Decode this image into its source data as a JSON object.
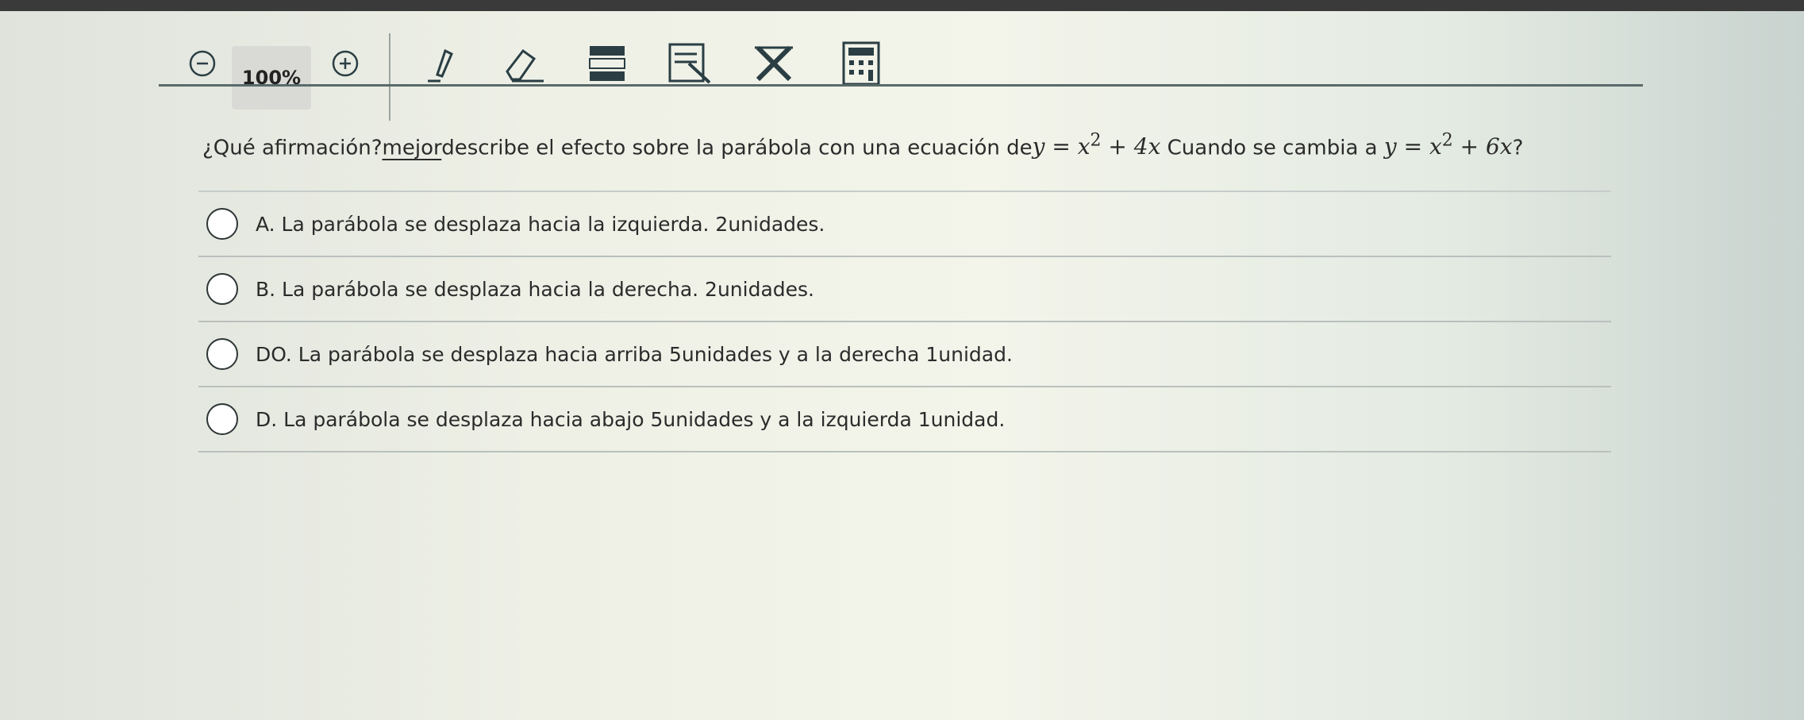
{
  "toolbar": {
    "zoom_level": "100%",
    "icons": [
      "zoom-out-icon",
      "zoom-in-icon",
      "pencil-icon",
      "eraser-icon",
      "line-reader-icon",
      "answer-masking-icon",
      "cross-out-icon",
      "calculator-icon"
    ]
  },
  "question": {
    "part1": "¿Qué afirmación?",
    "part2": "mejor",
    "part3": "describe el efecto sobre la parábola con una ecuación de",
    "eq1_a": "y = x",
    "eq1_exp": "2",
    "eq1_b": " + 4x",
    "part4": " Cuando se cambia a",
    "eq2_a": "y = x",
    "eq2_exp": "2",
    "eq2_b": " + 6x",
    "end": "?"
  },
  "options": [
    {
      "text": "A.   La parábola se desplaza hacia la izquierda. 2unidades."
    },
    {
      "text": "B.   La parábola se desplaza hacia la derecha. 2unidades."
    },
    {
      "text": "DO.  La parábola se desplaza hacia arriba 5unidades y a la derecha 1unidad."
    },
    {
      "text": "D.   La parábola se desplaza hacia abajo 5unidades y a la izquierda 1unidad."
    }
  ],
  "colors": {
    "toolbar_icon": "#2a3e44",
    "accent": "#2b4a52"
  }
}
